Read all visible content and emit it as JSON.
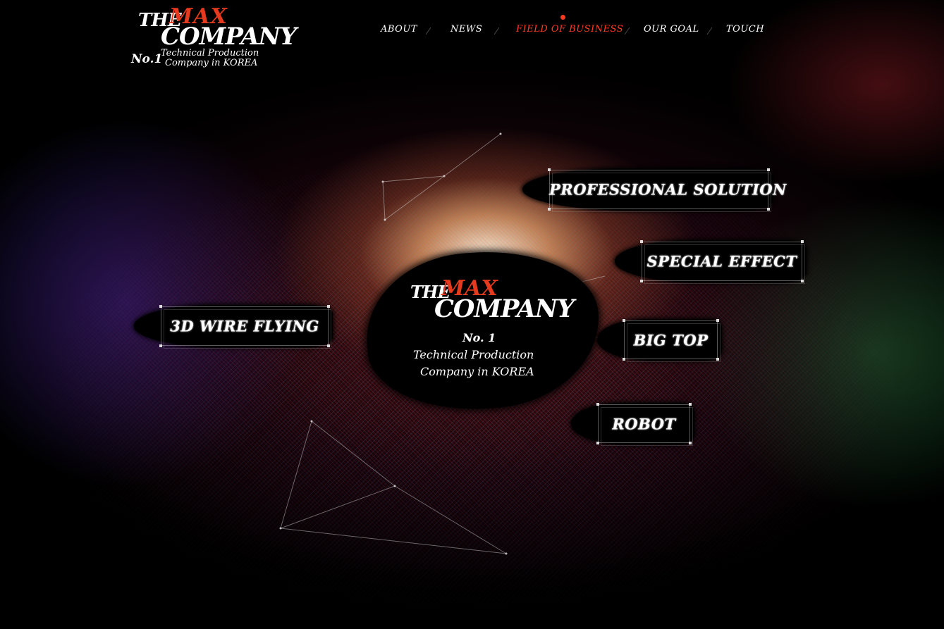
{
  "logo": {
    "the": "THE",
    "max": "MAX",
    "company": "COMPANY",
    "no1": "No.1",
    "tagline_1": "Technical Production",
    "tagline_2": "Company in KOREA"
  },
  "nav": {
    "items": [
      {
        "label": "ABOUT",
        "active": false
      },
      {
        "label": "NEWS",
        "active": false
      },
      {
        "label": "FIELD OF BUSINESS",
        "active": true
      },
      {
        "label": "OUR GOAL",
        "active": false
      },
      {
        "label": "TOUCH",
        "active": false
      }
    ]
  },
  "center": {
    "the": "THE",
    "max": "MAX",
    "company": "COMPANY",
    "line1": "No. 1",
    "line2": "Technical Production",
    "line3": "Company in KOREA"
  },
  "business": {
    "professional_solution": "PROFESSIONAL SOLUTION",
    "special_effect": "SPECIAL EFFECT",
    "wire_flying": "3D WIRE FLYING",
    "big_top": "BIG TOP",
    "robot": "ROBOT"
  },
  "colors": {
    "accent": "#e63a1e",
    "nav_active": "#ff3a26",
    "background": "#000000",
    "text": "#ffffff"
  }
}
